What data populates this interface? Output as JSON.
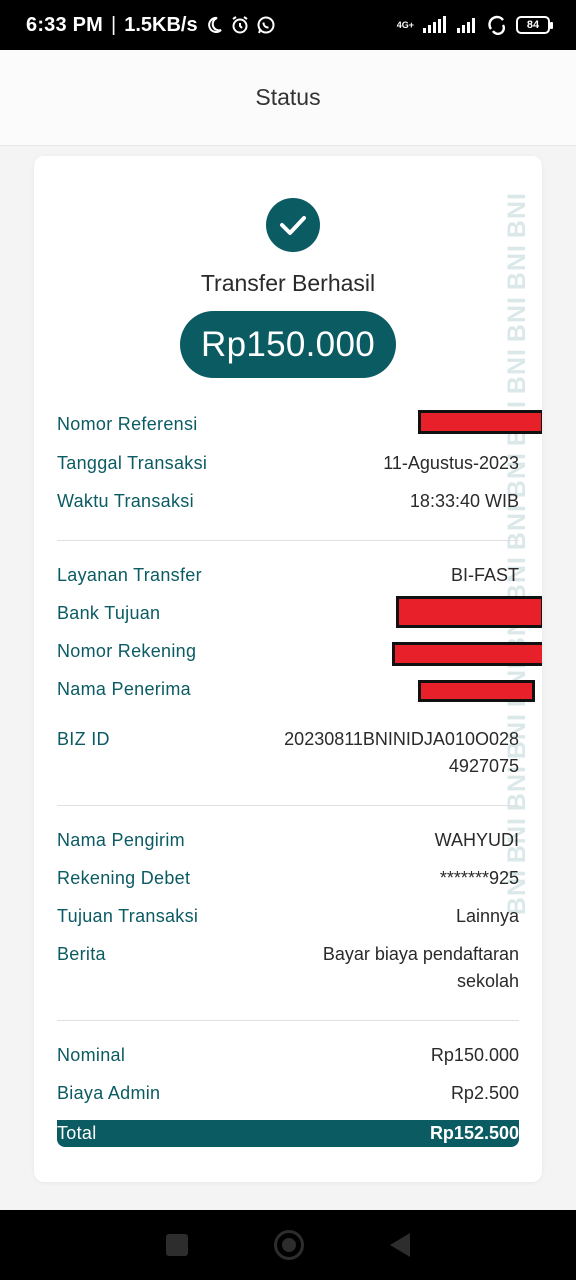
{
  "statusbar": {
    "time": "6:33 PM",
    "separator": "|",
    "speed": "1.5KB/s",
    "network": "4G+",
    "battery": "84"
  },
  "appbar": {
    "title": "Status"
  },
  "receipt": {
    "title": "Transfer Berhasil",
    "amount": "Rp150.000",
    "watermark": "BNI",
    "section1": {
      "nomor_referensi_label": "Nomor Referensi",
      "tanggal_label": "Tanggal Transaksi",
      "tanggal_value": "11-Agustus-2023",
      "waktu_label": "Waktu Transaksi",
      "waktu_value": "18:33:40 WIB"
    },
    "section2": {
      "layanan_label": "Layanan Transfer",
      "layanan_value": "BI-FAST",
      "bank_label": "Bank Tujuan",
      "rekening_label": "Nomor Rekening",
      "penerima_label": "Nama Penerima",
      "bizid_label": "BIZ ID",
      "bizid_line1": "20230811BNINIDJA010O028",
      "bizid_line2": "4927075"
    },
    "section3": {
      "pengirim_label": "Nama Pengirim",
      "pengirim_value": "WAHYUDI",
      "debet_label": "Rekening Debet",
      "debet_value": "*******925",
      "tujuan_label": "Tujuan Transaksi",
      "tujuan_value": "Lainnya",
      "berita_label": "Berita",
      "berita_line1": "Bayar biaya pendaftaran",
      "berita_line2": "sekolah"
    },
    "section4": {
      "nominal_label": "Nominal",
      "nominal_value": "Rp150.000",
      "admin_label": "Biaya Admin",
      "admin_value": "Rp2.500",
      "total_label": "Total",
      "total_value": "Rp152.500"
    }
  },
  "colors": {
    "brand": "#0b5b63",
    "redaction": "#e8202a"
  }
}
